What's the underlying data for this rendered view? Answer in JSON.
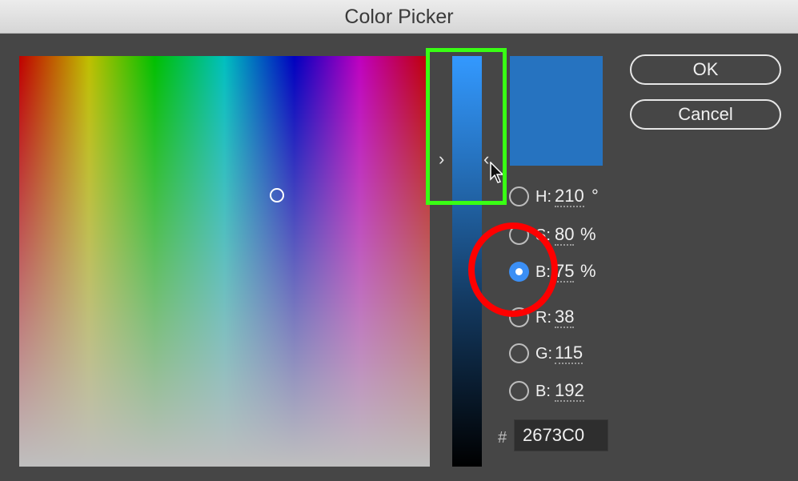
{
  "window": {
    "title": "Color Picker"
  },
  "buttons": {
    "ok": "OK",
    "cancel": "Cancel"
  },
  "current_color": "#2673C0",
  "fields": {
    "hue": {
      "label": "H:",
      "value": "210",
      "unit": "°",
      "selected": false
    },
    "saturation": {
      "label": "S:",
      "value": "80",
      "unit": "%",
      "selected": false
    },
    "brightness": {
      "label": "B:",
      "value": "75",
      "unit": "%",
      "selected": true
    },
    "red": {
      "label": "R:",
      "value": "38",
      "selected": false
    },
    "green": {
      "label": "G:",
      "value": "115",
      "selected": false
    },
    "blue": {
      "label": "B:",
      "value": "192",
      "selected": false
    }
  },
  "hex": {
    "symbol": "#",
    "value": "2673C0"
  },
  "annotations": {
    "highlight_box_color": "#39FF14",
    "highlight_circle_color": "#FF0000"
  }
}
